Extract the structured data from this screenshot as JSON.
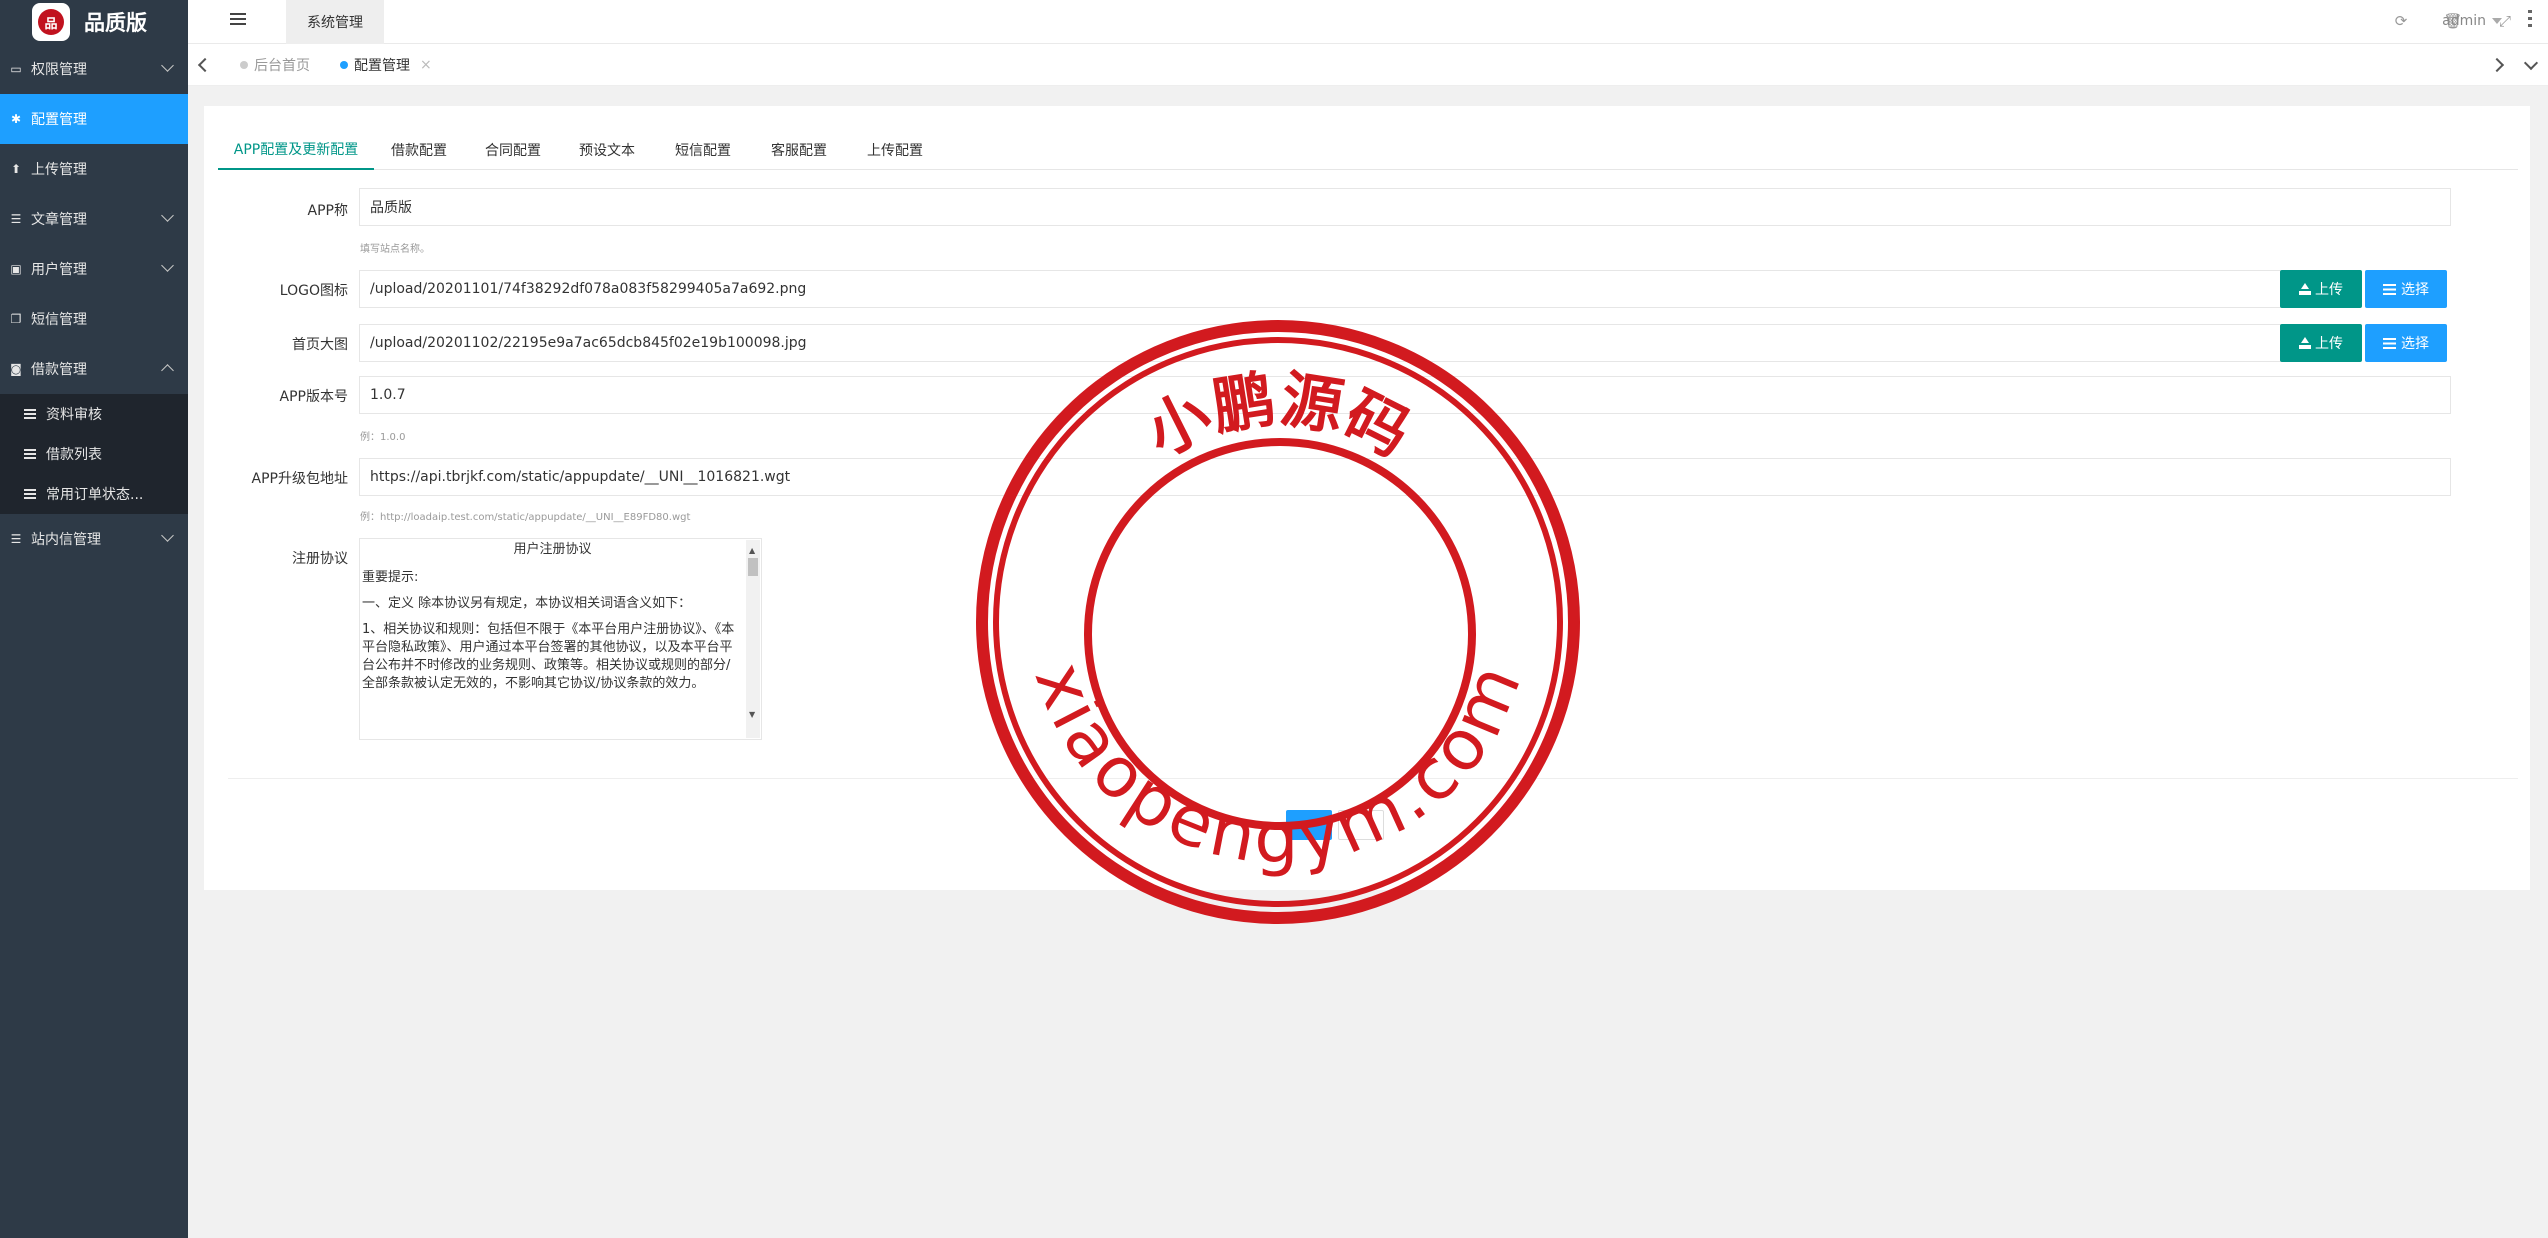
{
  "app": {
    "brand": "品质版",
    "logo_text": "品"
  },
  "sidebar": {
    "items": [
      {
        "label": "权限管理",
        "icon": "laptop-icon",
        "expand": "down"
      },
      {
        "label": "配置管理",
        "icon": "gear-icon",
        "active": true
      },
      {
        "label": "上传管理",
        "icon": "upload-icon"
      },
      {
        "label": "文章管理",
        "icon": "list-icon",
        "expand": "down"
      },
      {
        "label": "用户管理",
        "icon": "user-icon",
        "expand": "down"
      },
      {
        "label": "短信管理",
        "icon": "copy-icon"
      },
      {
        "label": "借款管理",
        "icon": "money-icon",
        "expand": "up"
      }
    ],
    "sub_items": [
      "资料审核",
      "借款列表",
      "常用订单状态..."
    ],
    "last_item": {
      "label": "站内信管理",
      "icon": "list-icon",
      "expand": "down"
    }
  },
  "header": {
    "system_tab": "系统管理",
    "user": "admin"
  },
  "tabs": {
    "home": "后台首页",
    "current": "配置管理"
  },
  "config_tabs": [
    "APP配置及更新配置",
    "借款配置",
    "合同配置",
    "预设文本",
    "短信配置",
    "客服配置",
    "上传配置"
  ],
  "form": {
    "app_name": {
      "label": "APP称",
      "value": "品质版",
      "hint": "填写站点名称。"
    },
    "logo": {
      "label": "LOGO图标",
      "value": "/upload/20201101/74f38292df078a083f58299405a7a692.png"
    },
    "banner": {
      "label": "首页大图",
      "value": "/upload/20201102/22195e9a7ac65dcb845f02e19b100098.jpg"
    },
    "version": {
      "label": "APP版本号",
      "value": "1.0.7",
      "hint": "例：1.0.0"
    },
    "update_url": {
      "label": "APP升级包地址",
      "value": "https://api.tbrjkf.com/static/appupdate/__UNI__1016821.wgt",
      "hint": "例：http://loadaip.test.com/static/appupdate/__UNI__E89FD80.wgt"
    },
    "agreement": {
      "label": "注册协议",
      "title": "用户注册协议",
      "paragraphs": [
        "重要提示:",
        "一、定义 除本协议另有规定，本协议相关词语含义如下：",
        "1、相关协议和规则：包括但不限于《本平台用户注册协议》、《本平台隐私政策》、用户通过本平台签署的其他协议，以及本平台平台公布并不时修改的业务规则、政策等。相关协议或规则的部分/全部条款被认定无效的，不影响其它协议/协议条款的效力。"
      ]
    },
    "upload_btn": "上传",
    "select_btn": "选择"
  },
  "watermark": {
    "top_text": "小鹏源码",
    "bottom_text": "xiaopengym.com",
    "color": "#d21a1f"
  }
}
